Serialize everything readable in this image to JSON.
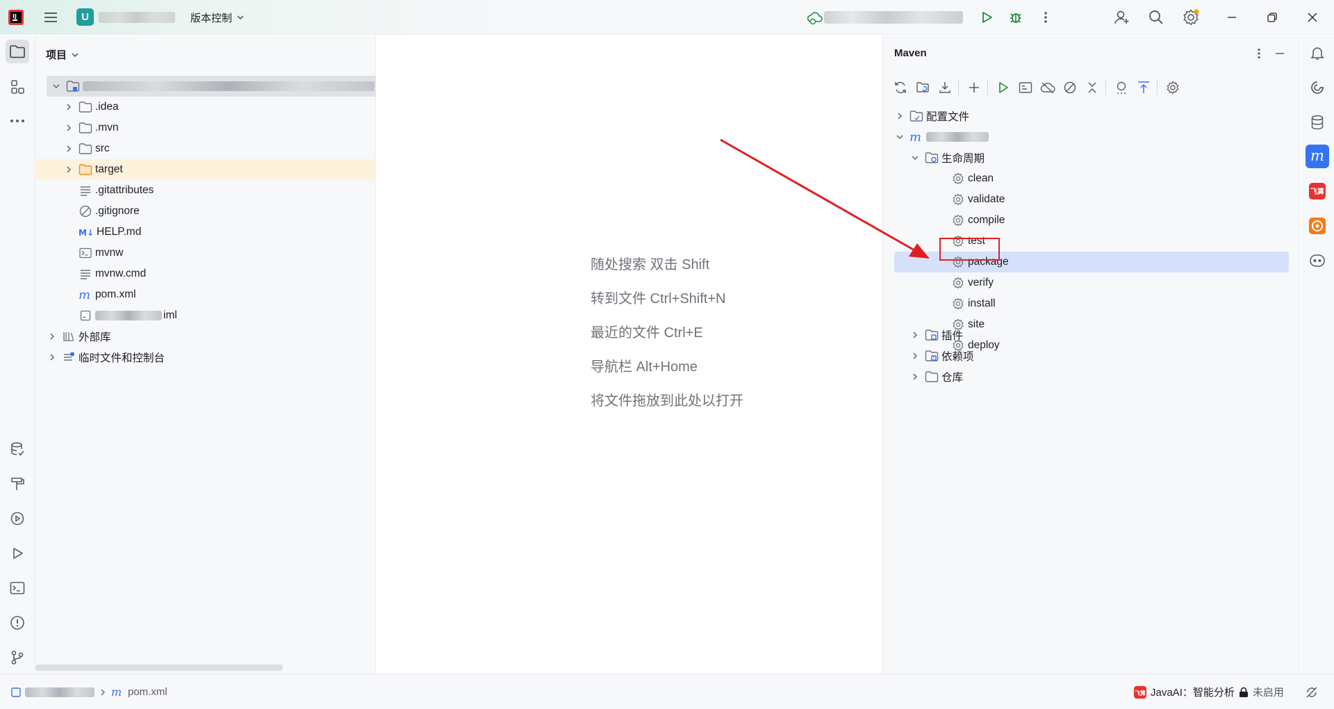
{
  "titlebar": {
    "project_badge": "U",
    "vcs_label": "版本控制",
    "icons": [
      "jetbrains-logo-icon",
      "main-menu-icon",
      "cloud-run-config-icon",
      "run-icon",
      "debug-icon",
      "more-icon",
      "add-user-icon",
      "search-icon",
      "settings-icon",
      "minimize-icon",
      "restore-icon",
      "close-icon"
    ]
  },
  "project_panel": {
    "title": "项目",
    "items": [
      {
        "label": ".idea",
        "icon": "folder-icon"
      },
      {
        "label": ".mvn",
        "icon": "folder-icon"
      },
      {
        "label": "src",
        "icon": "folder-icon"
      },
      {
        "label": "target",
        "icon": "folder-orange-icon"
      },
      {
        "label": ".gitattributes",
        "icon": "text-file-icon"
      },
      {
        "label": ".gitignore",
        "icon": "ignore-file-icon"
      },
      {
        "label": "HELP.md",
        "icon": "markdown-icon"
      },
      {
        "label": "mvnw",
        "icon": "shell-script-icon"
      },
      {
        "label": "mvnw.cmd",
        "icon": "text-file-icon"
      },
      {
        "label": "pom.xml",
        "icon": "maven-icon"
      },
      {
        "label": "iml",
        "icon": "iml-file-icon"
      },
      {
        "label": "外部库",
        "icon": "library-icon"
      },
      {
        "label": "临时文件和控制台",
        "icon": "scratch-icon"
      }
    ]
  },
  "editor": {
    "hints": [
      "随处搜索 双击 Shift",
      "转到文件 Ctrl+Shift+N",
      "最近的文件 Ctrl+E",
      "导航栏 Alt+Home",
      "将文件拖放到此处以打开"
    ]
  },
  "maven_panel": {
    "title": "Maven",
    "profiles": "配置文件",
    "lifecycle": "生命周期",
    "phases": [
      "clean",
      "validate",
      "compile",
      "test",
      "package",
      "verify",
      "install",
      "site",
      "deploy"
    ],
    "selected_phase": "package",
    "plugins": "插件",
    "dependencies": "依赖项",
    "repositories": "仓库"
  },
  "statusbar": {
    "breadcrumb_file": "pom.xml",
    "javaai_label": "JavaAI：智能分析",
    "javaai_status": "未启用"
  },
  "colors": {
    "accent": "#3574f0",
    "selection": "#d5e1fb",
    "arrow": "#e02020",
    "run_green": "#208a3c"
  }
}
